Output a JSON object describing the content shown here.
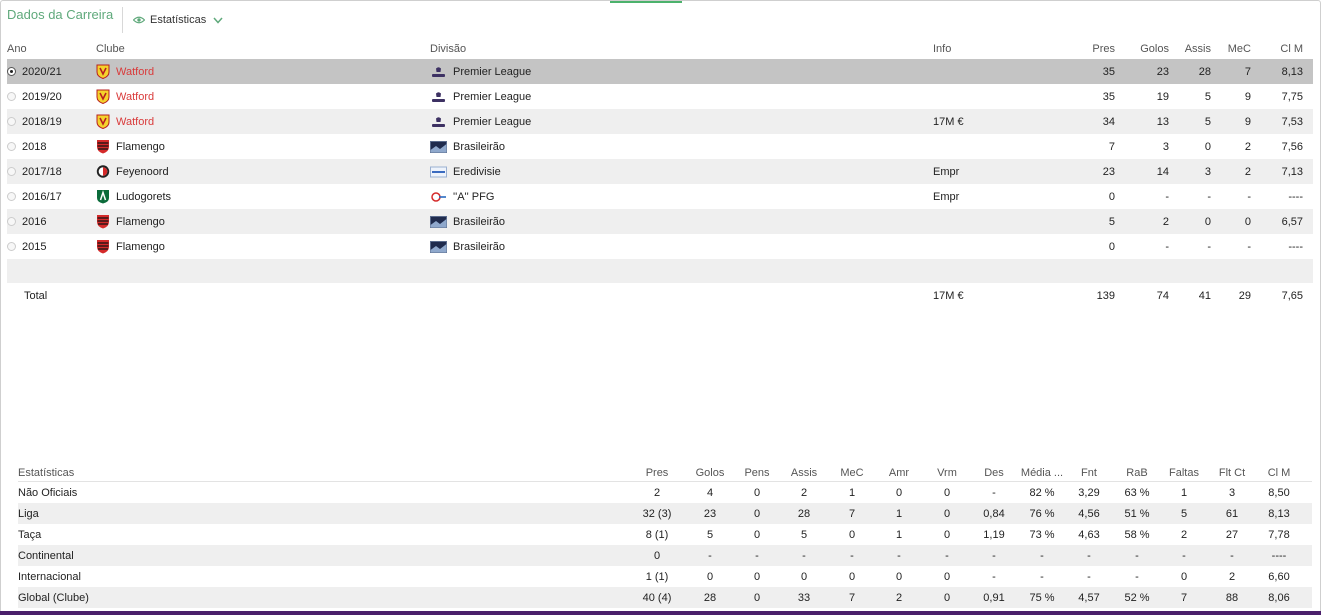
{
  "header": {
    "title": "Dados da Carreira",
    "view_label": "Estatísticas",
    "view_icon": "eye-icon",
    "dropdown_icon": "chevron-down-icon"
  },
  "colors": {
    "accent": "#5fa97b",
    "club_highlight": "#d93a3a",
    "selected_row": "#c4c4c4",
    "alt_row": "#efefef"
  },
  "career": {
    "columns": {
      "ano": "Ano",
      "clube": "Clube",
      "divisao": "Divisão",
      "info": "Info",
      "pres": "Pres",
      "golos": "Golos",
      "assis": "Assis",
      "mec": "MeC",
      "cim": "Cl M"
    },
    "rows": [
      {
        "ano": "2020/21",
        "clube": "Watford",
        "badge": "watford",
        "divisao": "Premier League",
        "comp": "premier",
        "info": "",
        "pres": "35",
        "golos": "23",
        "assis": "28",
        "mec": "7",
        "cim": "8,13"
      },
      {
        "ano": "2019/20",
        "clube": "Watford",
        "badge": "watford",
        "divisao": "Premier League",
        "comp": "premier",
        "info": "",
        "pres": "35",
        "golos": "19",
        "assis": "5",
        "mec": "9",
        "cim": "7,75"
      },
      {
        "ano": "2018/19",
        "clube": "Watford",
        "badge": "watford",
        "divisao": "Premier League",
        "comp": "premier",
        "info": "17M €",
        "pres": "34",
        "golos": "13",
        "assis": "5",
        "mec": "9",
        "cim": "7,53"
      },
      {
        "ano": "2018",
        "clube": "Flamengo",
        "badge": "flamengo",
        "divisao": "Brasileirão",
        "comp": "brasil",
        "info": "",
        "pres": "7",
        "golos": "3",
        "assis": "0",
        "mec": "2",
        "cim": "7,56"
      },
      {
        "ano": "2017/18",
        "clube": "Feyenoord",
        "badge": "feyenoord",
        "divisao": "Eredivisie",
        "comp": "eredivisie",
        "info": "Empr",
        "pres": "23",
        "golos": "14",
        "assis": "3",
        "mec": "2",
        "cim": "7,13"
      },
      {
        "ano": "2016/17",
        "clube": "Ludogorets",
        "badge": "ludogorets",
        "divisao": "''A'' PFG",
        "comp": "apfg",
        "info": "Empr",
        "pres": "0",
        "golos": "-",
        "assis": "-",
        "mec": "-",
        "cim": "----"
      },
      {
        "ano": "2016",
        "clube": "Flamengo",
        "badge": "flamengo",
        "divisao": "Brasileirão",
        "comp": "brasil",
        "info": "",
        "pres": "5",
        "golos": "2",
        "assis": "0",
        "mec": "0",
        "cim": "6,57"
      },
      {
        "ano": "2015",
        "clube": "Flamengo",
        "badge": "flamengo",
        "divisao": "Brasileirão",
        "comp": "brasil",
        "info": "",
        "pres": "0",
        "golos": "-",
        "assis": "-",
        "mec": "-",
        "cim": "----"
      }
    ],
    "total": {
      "label": "Total",
      "info": "17M €",
      "pres": "139",
      "golos": "74",
      "assis": "41",
      "mec": "29",
      "cim": "7,65"
    }
  },
  "stats": {
    "columns": {
      "label": "Estatísticas",
      "pres": "Pres",
      "golos": "Golos",
      "pens": "Pens",
      "assis": "Assis",
      "mec": "MeC",
      "amr": "Amr",
      "vrm": "Vrm",
      "des": "Des",
      "media": "Média ...",
      "fnt": "Fnt",
      "rab": "RaB",
      "faltas": "Faltas",
      "fltct": "Flt Ct",
      "cim": "Cl M"
    },
    "rows": [
      {
        "label": "Não Oficiais",
        "pres": "2",
        "golos": "4",
        "pens": "0",
        "assis": "2",
        "mec": "1",
        "amr": "0",
        "vrm": "0",
        "des": "-",
        "media": "82 %",
        "fnt": "3,29",
        "rab": "63 %",
        "faltas": "1",
        "fltct": "3",
        "cim": "8,50"
      },
      {
        "label": "Liga",
        "pres": "32 (3)",
        "golos": "23",
        "pens": "0",
        "assis": "28",
        "mec": "7",
        "amr": "1",
        "vrm": "0",
        "des": "0,84",
        "media": "76 %",
        "fnt": "4,56",
        "rab": "51 %",
        "faltas": "5",
        "fltct": "61",
        "cim": "8,13"
      },
      {
        "label": "Taça",
        "pres": "8 (1)",
        "golos": "5",
        "pens": "0",
        "assis": "5",
        "mec": "0",
        "amr": "1",
        "vrm": "0",
        "des": "1,19",
        "media": "73 %",
        "fnt": "4,63",
        "rab": "58 %",
        "faltas": "2",
        "fltct": "27",
        "cim": "7,78"
      },
      {
        "label": "Continental",
        "pres": "0",
        "golos": "-",
        "pens": "-",
        "assis": "-",
        "mec": "-",
        "amr": "-",
        "vrm": "-",
        "des": "-",
        "media": "-",
        "fnt": "-",
        "rab": "-",
        "faltas": "-",
        "fltct": "-",
        "cim": "----"
      },
      {
        "label": "Internacional",
        "pres": "1 (1)",
        "golos": "0",
        "pens": "0",
        "assis": "0",
        "mec": "0",
        "amr": "0",
        "vrm": "0",
        "des": "-",
        "media": "-",
        "fnt": "-",
        "rab": "-",
        "faltas": "0",
        "fltct": "2",
        "cim": "6,60"
      },
      {
        "label": "Global (Clube)",
        "pres": "40 (4)",
        "golos": "28",
        "pens": "0",
        "assis": "33",
        "mec": "7",
        "amr": "2",
        "vrm": "0",
        "des": "0,91",
        "media": "75 %",
        "fnt": "4,57",
        "rab": "52 %",
        "faltas": "7",
        "fltct": "88",
        "cim": "8,06"
      }
    ]
  }
}
